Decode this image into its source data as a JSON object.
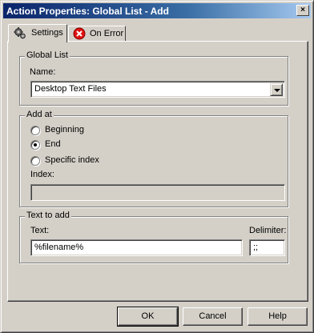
{
  "window": {
    "title": "Action Properties: Global List - Add",
    "close_glyph": "×"
  },
  "tabs": [
    {
      "label": "Settings",
      "icon": "gears-icon",
      "active": true
    },
    {
      "label": "On Error",
      "icon": "error-icon",
      "active": false
    }
  ],
  "global_list": {
    "group_title": "Global List",
    "name_label": "Name:",
    "name_value": "Desktop Text Files"
  },
  "add_at": {
    "group_title": "Add at",
    "options": [
      {
        "label": "Beginning",
        "checked": false
      },
      {
        "label": "End",
        "checked": true
      },
      {
        "label": "Specific index",
        "checked": false
      }
    ],
    "index_label": "Index:",
    "index_value": ""
  },
  "text_to_add": {
    "group_title": "Text to add",
    "text_label": "Text:",
    "text_value": "%filename%",
    "delimiter_label": "Delimiter:",
    "delimiter_value": ";;"
  },
  "buttons": {
    "ok": "OK",
    "cancel": "Cancel",
    "help": "Help"
  },
  "colors": {
    "face": "#d4d0c8",
    "title_start": "#0a246a",
    "title_end": "#a6caf0",
    "error_red": "#e01010"
  }
}
